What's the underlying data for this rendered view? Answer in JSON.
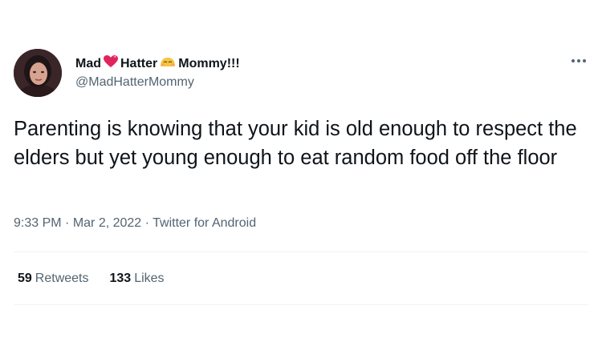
{
  "tweet": {
    "author": {
      "name_part1": "Mad",
      "name_emoji1": "heart-with-ribbon-emoji",
      "name_part2": "Hatter",
      "name_emoji2": "smiling-face-emoji",
      "name_part3": "Mommy!!!",
      "handle": "@MadHatterMommy"
    },
    "more_icon": "more-options-icon",
    "text": "Parenting is knowing that your kid is old enough to respect the elders but yet young enough to eat random food off the floor",
    "meta": {
      "time": "9:33 PM",
      "sep1": " · ",
      "date": "Mar 2, 2022",
      "sep2": " · ",
      "source": "Twitter for Android"
    },
    "stats": {
      "retweets_count": "59",
      "retweets_label": "Retweets",
      "likes_count": "133",
      "likes_label": "Likes"
    }
  },
  "colors": {
    "text": "#0f1419",
    "secondary": "#536471",
    "divider": "#eff3f4",
    "heart": "#e0245e"
  }
}
